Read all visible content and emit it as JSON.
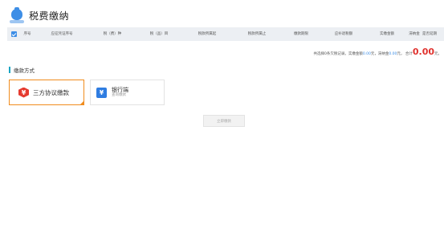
{
  "header": {
    "title": "税费缴纳",
    "icon": "money-bag-icon"
  },
  "table": {
    "columns": [
      "序号",
      "应征凭证序号",
      "税（费）种",
      "税（品）目",
      "税款所属起",
      "税款所属止",
      "缴款期限",
      "应补退税额",
      "实缴金额",
      "滞纳金",
      "是否延期"
    ],
    "rows": []
  },
  "summary": {
    "prefix": "共选择0条欠税记录。实缴金额",
    "paid": "0.00",
    "mid1": "元，滞纳金",
    "late_fee": "0.00",
    "mid2": "元， 合计",
    "total": "0.00",
    "unit": "元。"
  },
  "payment_section": {
    "title": "缴款方式",
    "accent_color": "#1aa5c3",
    "methods": [
      {
        "label": "三方协议缴款",
        "icon": "tripartite-agreement-icon",
        "selected": true,
        "color": "#e53a2f"
      },
      {
        "label": "银行端",
        "sublabel": "查询缴款",
        "icon": "bank-icon",
        "selected": false,
        "color": "#2f7de1"
      }
    ]
  },
  "actions": {
    "pay_now": "立即缴款"
  }
}
